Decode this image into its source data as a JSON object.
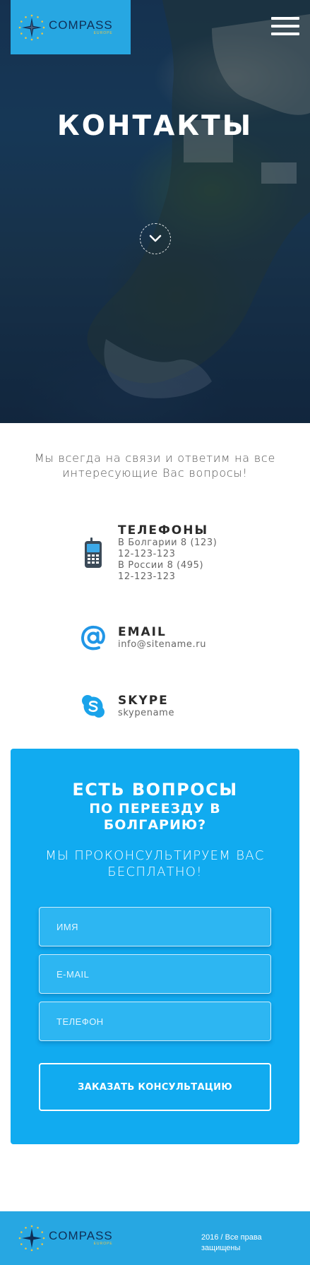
{
  "brand": {
    "name": "COMPASS",
    "sub": "EUROPE",
    "accent": "#27a7e2",
    "cta_color": "#11abf0"
  },
  "header": {
    "menu_icon": "hamburger-icon"
  },
  "hero": {
    "title": "КОНТАКТЫ",
    "scroll_icon": "chevron-down-icon"
  },
  "intro": {
    "text": "Мы всегда на связи и ответим на все интересующие Вас вопросы!"
  },
  "contacts": {
    "phone": {
      "icon": "mobile-phone-icon",
      "title": "ТЕЛЕФОНЫ",
      "lines": [
        "В Болгарии 8 (123)",
        "12-123-123",
        "В России 8 (495)",
        "12-123-123"
      ]
    },
    "email": {
      "icon": "at-sign-icon",
      "title": "EMAIL",
      "value": "info@sitename.ru"
    },
    "skype": {
      "icon": "skype-icon",
      "title": "SKYPE",
      "value": "skypename"
    }
  },
  "cta": {
    "title": "ЕСТЬ ВОПРОСЫ",
    "subtitle": "ПО ПЕРЕЕЗДУ В БОЛГАРИЮ?",
    "free": "МЫ ПРОКОНСУЛЬТИРУЕМ ВАС БЕСПЛАТНО!",
    "form": {
      "name_placeholder": "ИМЯ",
      "email_placeholder": "E-MAIL",
      "phone_placeholder": "ТЕЛЕФОН",
      "submit_label": "ЗАКАЗАТЬ КОНСУЛЬТАЦИЮ"
    }
  },
  "footer": {
    "copyright": "2016 / Все права защищены"
  }
}
